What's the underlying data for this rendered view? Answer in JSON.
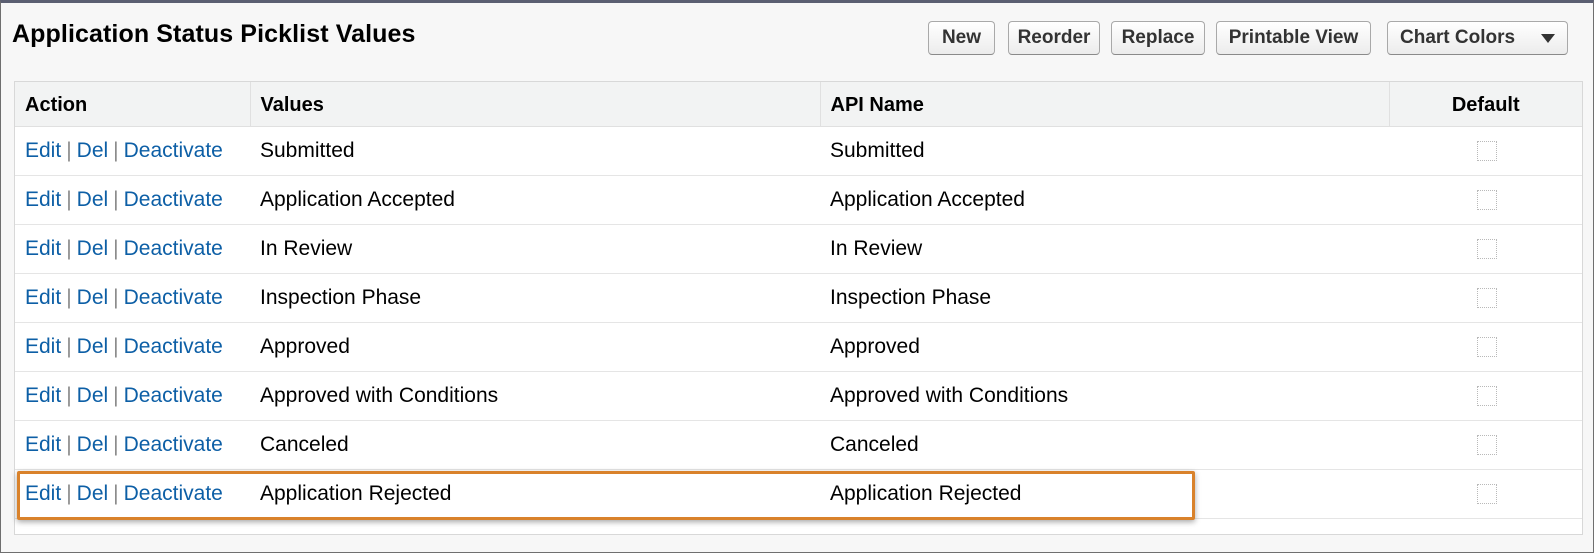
{
  "page": {
    "title": "Application Status Picklist Values"
  },
  "toolbar": {
    "new_label": "New",
    "reorder_label": "Reorder",
    "replace_label": "Replace",
    "printable_label": "Printable View",
    "chart_colors_label": "Chart Colors",
    "chart_colors_icon": "chevron-down-icon"
  },
  "table": {
    "headers": {
      "action": "Action",
      "values": "Values",
      "api_name": "API Name",
      "default": "Default"
    },
    "action_labels": {
      "edit": "Edit",
      "del": "Del",
      "deactivate": "Deactivate",
      "separator": "|"
    },
    "rows": [
      {
        "value": "Submitted",
        "api_name": "Submitted",
        "default": false
      },
      {
        "value": "Application Accepted",
        "api_name": "Application Accepted",
        "default": false
      },
      {
        "value": "In Review",
        "api_name": "In Review",
        "default": false
      },
      {
        "value": "Inspection Phase",
        "api_name": "Inspection Phase",
        "default": false
      },
      {
        "value": "Approved",
        "api_name": "Approved",
        "default": false
      },
      {
        "value": "Approved with Conditions",
        "api_name": "Approved with Conditions",
        "default": false
      },
      {
        "value": "Canceled",
        "api_name": "Canceled",
        "default": false
      },
      {
        "value": "Application Rejected",
        "api_name": "Application Rejected",
        "default": false
      }
    ]
  },
  "colors": {
    "link": "#0d5fa6",
    "highlight": "#d9822b",
    "header_bg": "#f2f3f3",
    "frame_bg": "#f7f7f7"
  }
}
